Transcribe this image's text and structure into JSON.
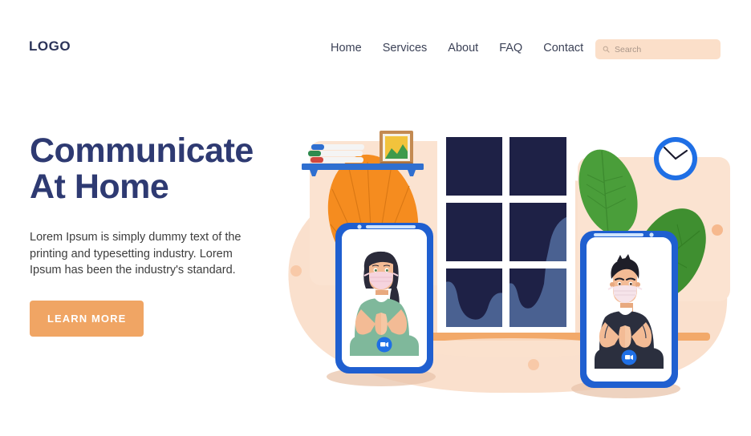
{
  "header": {
    "logo": "LOGO",
    "nav": [
      {
        "label": "Home",
        "name": "nav-item-home"
      },
      {
        "label": "Services",
        "name": "nav-item-services"
      },
      {
        "label": "About",
        "name": "nav-item-about"
      },
      {
        "label": "FAQ",
        "name": "nav-item-faq"
      },
      {
        "label": "Contact",
        "name": "nav-item-contact"
      }
    ],
    "search": {
      "placeholder": "Search",
      "value": "",
      "icon": "search-icon",
      "background": "#fbdfc9"
    }
  },
  "hero": {
    "title_line1": "Communicate",
    "title_line2": "At Home",
    "title_color": "#2e3a72",
    "body": "Lorem Ipsum is simply dummy text of the printing and typesetting industry. Lorem Ipsum has been the industry's standard.",
    "cta_label": "LEARN MORE",
    "cta_color": "#f0a564",
    "cta_text_color": "#ffffff"
  },
  "illustration": {
    "alt": "Two people on a video call doing yoga at home",
    "scene": {
      "backdrop_color": "#fae0cd",
      "blob_color": "#fad5bd",
      "wall_color": "#ffffff"
    },
    "shelf": {
      "board_color": "#2f6fd0",
      "books": [
        {
          "spine_color": "#2f6fd0"
        },
        {
          "spine_color": "#2f8a4e"
        },
        {
          "spine_color": "#d0473f"
        }
      ],
      "frame": {
        "frame_color": "#a9713f",
        "sky_color": "#f2c33c",
        "land_color": "#3f9a4b"
      }
    },
    "window": {
      "frame_color": "#ffffff",
      "glass_color": "#1e2146",
      "hill_color": "#4a6191",
      "sill_color": "#f2a96a",
      "rows": 3,
      "cols": 2
    },
    "clock": {
      "ring_color": "#1f6fe5",
      "face_color": "#ffffff",
      "hand_color": "#1a1a2e",
      "time": "10:10"
    },
    "plants": {
      "orange_fan_color": "#f58c1f",
      "leaf_color_1": "#4a9e3a",
      "leaf_color_2": "#3f8f30"
    },
    "phone_left": {
      "frame_color": "#1f5fd0",
      "screen_color": "#ffffff",
      "person": "woman-yoga-mask",
      "hair_color": "#2b2b3a",
      "skin_color": "#f3bb95",
      "shirt_color": "#7fb89b",
      "mask_color": "#f6d4de",
      "call_button": {
        "color": "#1f6fe5",
        "icon": "video-camera-icon"
      }
    },
    "phone_right": {
      "frame_color": "#1f5fd0",
      "screen_color": "#ffffff",
      "person": "man-yoga-mask",
      "hair_color": "#1e1e28",
      "skin_color": "#f3bb95",
      "shirt_color": "#2b2f3e",
      "mask_color": "#f6e4ea",
      "call_button": {
        "color": "#1f6fe5",
        "icon": "video-camera-icon"
      }
    },
    "dots": [
      {
        "color": "#f8c9a8"
      },
      {
        "color": "#f8c9a8"
      },
      {
        "color": "#f6b98e"
      }
    ]
  }
}
